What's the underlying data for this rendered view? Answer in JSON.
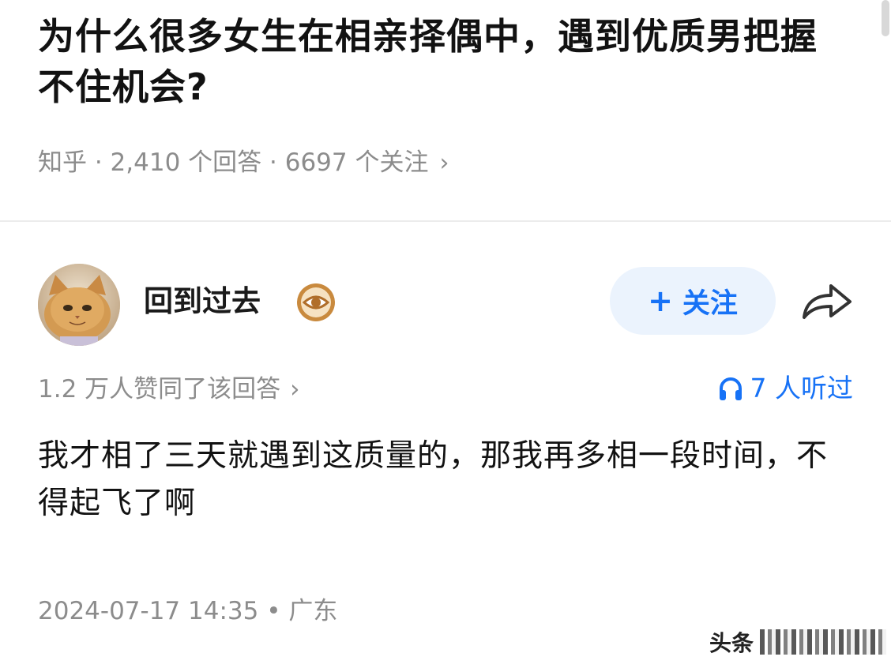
{
  "question": {
    "title": "为什么很多女生在相亲择偶中，遇到优质男把握不住机会?",
    "meta": "知乎 · 2,410 个回答 · 6697 个关注",
    "meta_chevron": "›"
  },
  "author": {
    "name": "回到过去",
    "avatar_icon": "cat-avatar",
    "badge_icon": "eye-badge-icon"
  },
  "actions": {
    "follow_plus": "+",
    "follow_label": "关注",
    "share_icon": "share-arrow-icon"
  },
  "answer": {
    "upvote_summary": "1.2 万人赞同了该回答",
    "upvote_chevron": "›",
    "listened": "7 人听过",
    "listened_icon": "headphones-icon",
    "body": "我才相了三天就遇到这质量的，那我再多相一段时间，不得起飞了啊",
    "footer": "2024-07-17 14:35 • 广东"
  },
  "watermark": {
    "text": "头条"
  },
  "colors": {
    "accent": "#1772f6",
    "follow_bg": "#ebf3fd",
    "meta_gray": "#8c8c8c",
    "title": "#121212"
  }
}
